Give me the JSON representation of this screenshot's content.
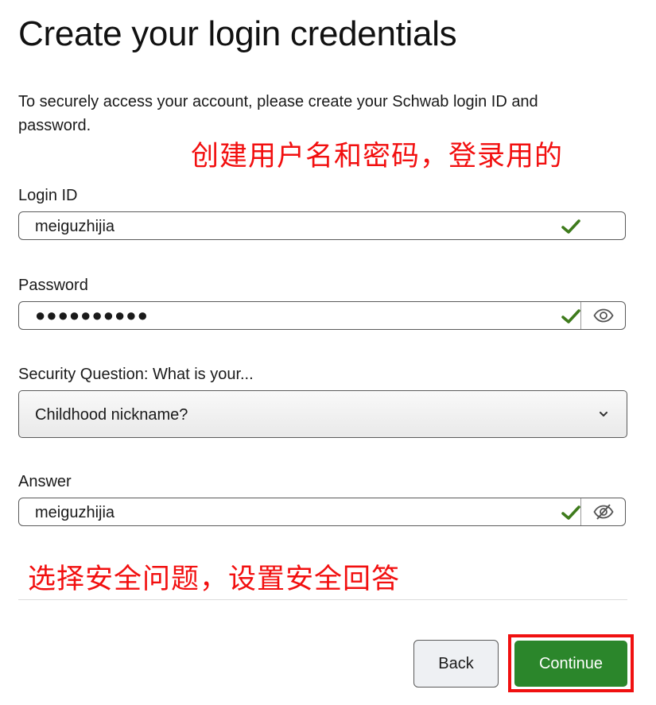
{
  "page": {
    "title": "Create your login credentials",
    "intro": "To securely access your account, please create your Schwab login ID and password."
  },
  "annotations": {
    "top": "创建用户名和密码，登录用的",
    "bottom": "选择安全问题，设置安全回答"
  },
  "form": {
    "login_id": {
      "label": "Login ID",
      "value": "meiguzhijia"
    },
    "password": {
      "label": "Password",
      "value": "●●●●●●●●●●"
    },
    "security_question": {
      "label": "Security Question: What is your...",
      "selected": "Childhood nickname?"
    },
    "answer": {
      "label": "Answer",
      "value": "meiguzhijia"
    }
  },
  "buttons": {
    "back": "Back",
    "continue": "Continue"
  },
  "colors": {
    "check": "#3e7b1c",
    "continue_bg": "#2b862b",
    "annotation": "#f20f0f"
  }
}
